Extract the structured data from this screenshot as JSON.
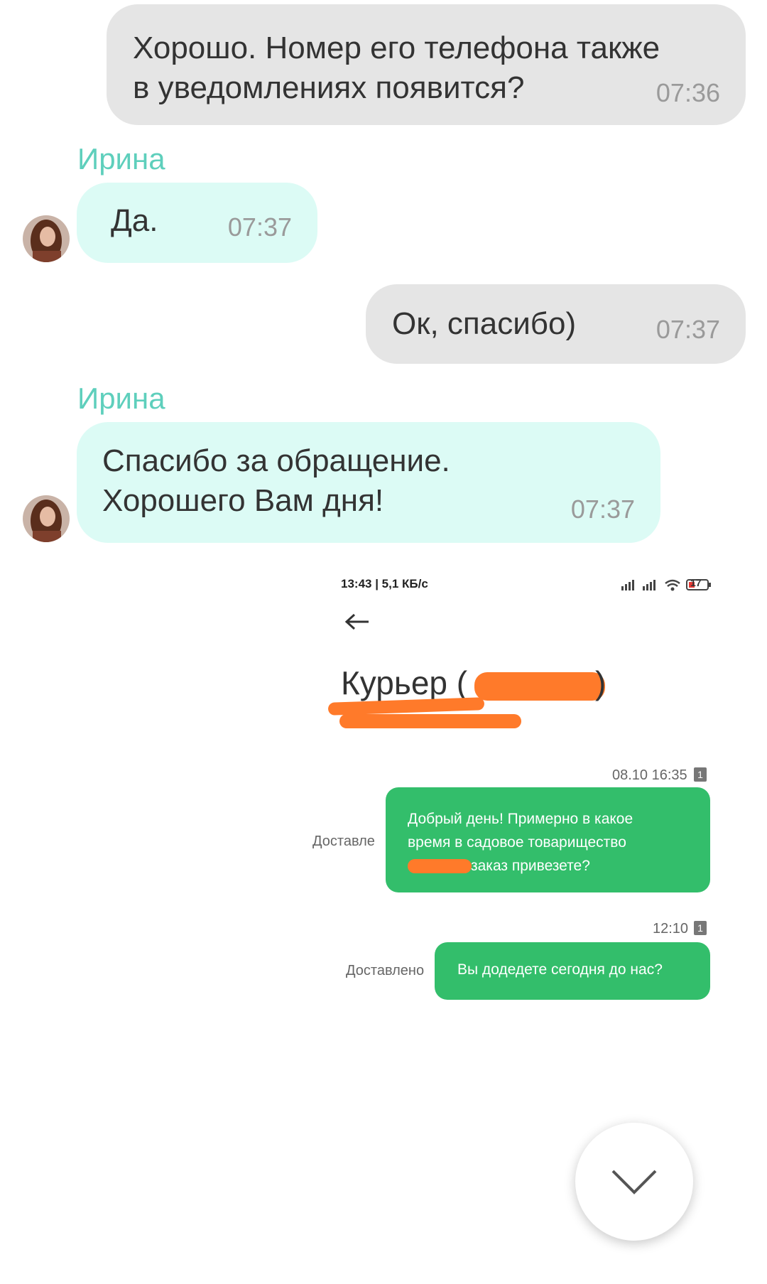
{
  "messages": [
    {
      "text": "Хорошо. Номер его телефона также\nв уведомлениях появится?",
      "time": "07:36"
    },
    {
      "sender": "Ирина",
      "text": "Да.",
      "time": "07:37"
    },
    {
      "text": "Ок, спасибо)",
      "time": "07:37"
    },
    {
      "sender": "Ирина",
      "text": "Спасибо за обращение.\nХорошего Вам дня!",
      "time": "07:37"
    }
  ],
  "embedded_screenshot": {
    "status_bar": {
      "time_speed": "13:43 | 5,1 КБ/с",
      "battery": "17"
    },
    "title": "Курьер (",
    "title_suffix": ")",
    "messages": [
      {
        "timestamp": "08.10 16:35",
        "badge": "1",
        "status": "Доставле",
        "lines": [
          "Добрый день! Примерно в какое",
          "время в садовое товарищество",
          "заказ привезете?"
        ]
      },
      {
        "timestamp": "12:10",
        "badge": "1",
        "status": "Доставлено",
        "text": "Вы додедете сегодня до нас?"
      }
    ]
  },
  "colors": {
    "incoming": "#dcfbf5",
    "outgoing": "#e5e5e5",
    "sender_name": "#5ecfbc",
    "sms_bubble": "#33be6b",
    "redaction": "#ff7a2a"
  }
}
